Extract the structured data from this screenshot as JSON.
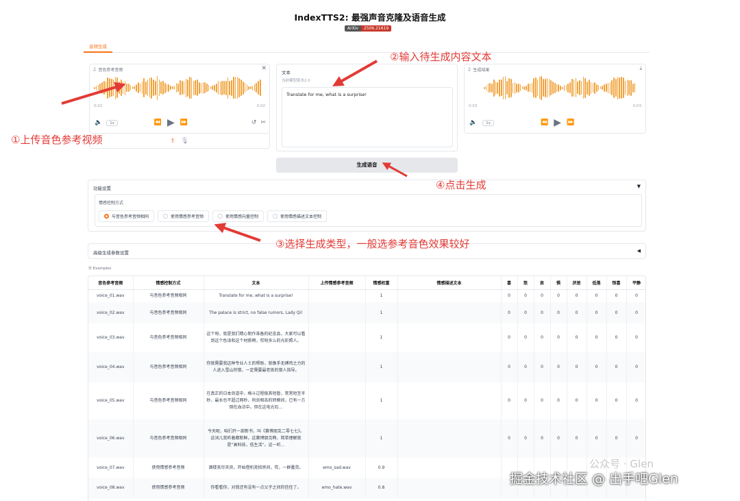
{
  "app": {
    "title": "IndexTTS2: 最强声音克隆及语音生成",
    "badge_left": "ArXiv",
    "badge_right": "2506.21619"
  },
  "tabs": [
    {
      "label": "音频生成"
    }
  ],
  "ref_audio": {
    "label": "音色参考音频",
    "time_start": "0:02",
    "time_end": "0:02",
    "speed": "1x"
  },
  "text_input": {
    "label": "文本",
    "hint": "当前模型版本2.0",
    "value": "Translate for me, what is a surprise!"
  },
  "result_audio": {
    "label": "生成结果",
    "time_start": "0:03",
    "time_end": "0:03",
    "speed": "1x"
  },
  "generate_button": "生成语音",
  "func_settings": {
    "title": "功能设置",
    "toggle": "▼",
    "emo_label": "情感控制方式",
    "options": [
      "与音色参考音频相同",
      "使用情感参考音频",
      "使用情感向量控制",
      "使用情感描述文本控制"
    ]
  },
  "advanced": {
    "title": "高级生成参数设置",
    "toggle": "◀"
  },
  "examples_label": "Examples",
  "table": {
    "headers": [
      "音色参考音频",
      "情感控制方式",
      "文本",
      "上传情感参考音频",
      "情感权重",
      "情感描述文本",
      "喜",
      "怒",
      "哀",
      "惧",
      "厌恶",
      "低落",
      "惊喜",
      "平静"
    ],
    "rows": [
      {
        "audio": "voice_01.wav",
        "mode": "与音色参考音频相同",
        "text": "Translate for me, what is a surprise!",
        "emo_audio": "",
        "weight": "1",
        "desc": "",
        "v": [
          "0",
          "0",
          "0",
          "0",
          "0",
          "0",
          "0",
          "0"
        ]
      },
      {
        "audio": "voice_02.wav",
        "mode": "与音色参考音频相同",
        "text": "The palace is strict, no false rumors, Lady Qi!",
        "emo_audio": "",
        "weight": "1",
        "desc": "",
        "v": [
          "0",
          "0",
          "0",
          "0",
          "0",
          "0",
          "0",
          "0"
        ]
      },
      {
        "audio": "voice_03.wav",
        "mode": "与音色参考音频相同",
        "text": "这个呀，就是我们精心制作准备的纪念品，大家可以看到这个色泽和这个材质啊，哎呀多么的光彩照人。",
        "emo_audio": "",
        "weight": "1",
        "desc": "",
        "v": [
          "0",
          "0",
          "0",
          "0",
          "0",
          "0",
          "0",
          "0"
        ]
      },
      {
        "audio": "voice_04.wav",
        "mode": "与音色参考音频相同",
        "text": "你就需要我这种专业人士的帮助，就像手无缚鸡之力的人进入雪山狩猎，一定需要最老练的猎人指导。",
        "emo_audio": "",
        "weight": "1",
        "desc": "",
        "v": [
          "0",
          "0",
          "0",
          "0",
          "0",
          "0",
          "0",
          "0"
        ]
      },
      {
        "audio": "voice_05.wav",
        "mode": "与音色参考音频相同",
        "text": "在真正的日本剑道中，格斗过程极其短暂，常常短至半秒，最长也不超过两秒，利剑相击的转瞬间，已有一方倒在血泊中。但在这电光石...",
        "emo_audio": "",
        "weight": "1",
        "desc": "",
        "v": [
          "0",
          "0",
          "0",
          "0",
          "0",
          "0",
          "0",
          "0"
        ]
      },
      {
        "audio": "voice_06.wav",
        "mode": "与音色参考音频相同",
        "text": "今天呢，咱们开一部新书，叫《赛博朋克二零七七》。这词儿我听着都新鲜。这赛博朋克啊，简单理解就是“高科技，低生活”。这一听...",
        "emo_audio": "",
        "weight": "1",
        "desc": "",
        "v": [
          "0",
          "0",
          "0",
          "0",
          "0",
          "0",
          "0",
          "0"
        ]
      },
      {
        "audio": "voice_07.wav",
        "mode": "使用情感参考音频",
        "text": "酒楼丧尽天良，开始借机竞拍房间，哎，一群蠢货。",
        "emo_audio": "emo_sad.wav",
        "weight": "0.9",
        "desc": "",
        "v": [
          "",
          "",
          "",
          "",
          "",
          "",
          "",
          ""
        ]
      },
      {
        "audio": "voice_08.wav",
        "mode": "使用情感参考音频",
        "text": "你看看你，对我还有没有一点父子之间的信任了。",
        "emo_audio": "emo_hate.wav",
        "weight": "0.8",
        "desc": "",
        "v": [
          "",
          "",
          "",
          "",
          "",
          "",
          "",
          ""
        ]
      }
    ]
  },
  "annotations": {
    "a1": "①上传音色参考视频",
    "a2": "②输入待生成内容文本",
    "a3": "③选择生成类型，一般选参考音色效果较好",
    "a4": "④点击生成"
  },
  "watermark": {
    "w1": "公众号 · Glen",
    "w2": "掘金技术社区 @ 出手吧Glen"
  }
}
